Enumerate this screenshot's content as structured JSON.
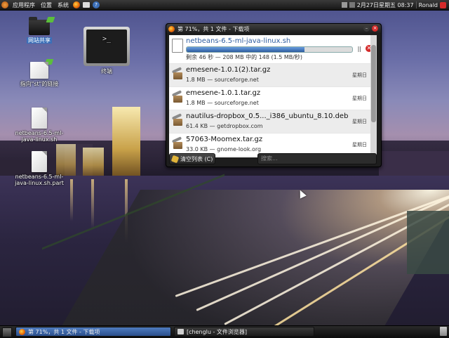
{
  "top_panel": {
    "menus": [
      "应用程序",
      "位置",
      "系统"
    ],
    "clock": "2月27日星期五 08:37",
    "user": "Ronald"
  },
  "desktop_icons": [
    {
      "label": "网站共享",
      "selected": true
    },
    {
      "label": "指向\"st\"的链接",
      "selected": false
    },
    {
      "label": "netbeans-6.5-ml-java-linux.sh",
      "selected": false
    },
    {
      "label": "netbeans-6.5-ml-java-linux.sh.part",
      "selected": false
    },
    {
      "label": "终端",
      "selected": false
    }
  ],
  "downloads_window": {
    "title": "第 71%，共 1 文件 - 下载项",
    "active_download": {
      "name": "netbeans-6.5-ml-java-linux.sh",
      "status": "剩余 46 秒 — 208 MB 中的 148 (1.5 MB/秒)",
      "progress": 0.71,
      "pause_label": "||",
      "cancel_label": "✕"
    },
    "items": [
      {
        "name": "emesene-1.0.1(2).tar.gz",
        "meta": "1.8 MB — sourceforge.net",
        "when": "星期日"
      },
      {
        "name": "emesene-1.0.1.tar.gz",
        "meta": "1.8 MB — sourceforge.net",
        "when": "星期日"
      },
      {
        "name": "nautilus-dropbox_0.5..._i386_ubuntu_8.10.deb",
        "meta": "61.4 KB — getdropbox.com",
        "when": "星期日"
      },
      {
        "name": "57063-Moomex.tar.gz",
        "meta": "33.0 KB — gnome-look.org",
        "when": "星期日"
      }
    ],
    "clear_button": "清空列表 (C)",
    "search_placeholder": "搜索..."
  },
  "taskbar": {
    "tasks": [
      {
        "label": "第 71%，共 1 文件 - 下载项",
        "active": true
      },
      {
        "label": "[chenglu - 文件浏览器]",
        "active": false
      }
    ]
  },
  "colors": {
    "selection": "#3b6fb8",
    "progress": "#2e5c9e",
    "cancel": "#d42a2a"
  },
  "icons": [
    "ubuntu-logo-icon",
    "firefox-icon",
    "mail-icon",
    "help-icon",
    "folder-icon",
    "file-icon",
    "terminal-icon",
    "package-icon",
    "close-icon",
    "pause-icon",
    "broom-icon",
    "trash-icon",
    "mute-icon"
  ]
}
